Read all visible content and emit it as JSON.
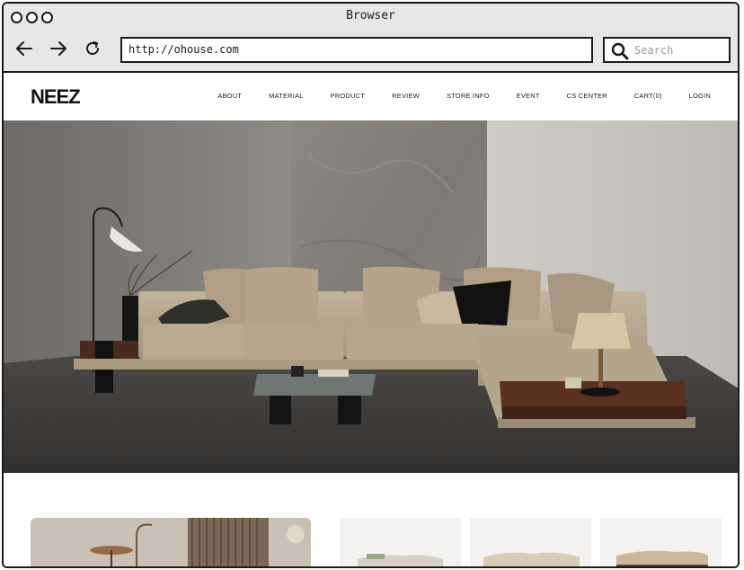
{
  "browser": {
    "title": "Browser",
    "url": "http://ohouse.com",
    "search_placeholder": "Search"
  },
  "site": {
    "logo_text": "NEEZ",
    "menu": [
      "ABOUT",
      "MATERIAL",
      "PRODUCT",
      "REVIEW",
      "STORE INFO",
      "EVENT",
      "CS CENTER",
      "CART(0)",
      "LOGIN"
    ]
  },
  "icons": [
    "back-arrow-icon",
    "forward-arrow-icon",
    "reload-icon",
    "search-icon"
  ],
  "colors": {
    "chrome": "#e7e7e7",
    "outline": "#1b1b1b",
    "sofa": "#b9a88f",
    "floor": "#3e3c3a"
  }
}
